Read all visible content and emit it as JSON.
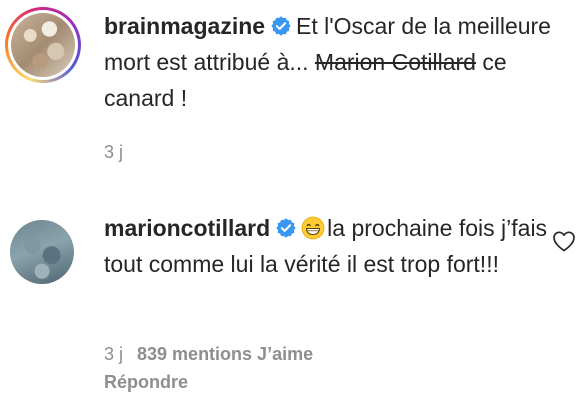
{
  "comments": [
    {
      "username": "brainmagazine",
      "text_before": "Et l'Oscar de la meilleure mort est attribué à... ",
      "strikethrough_text": "Marion Cotillard",
      "text_after": " ce canard !",
      "time": "3 j"
    },
    {
      "username": "marioncotillard",
      "emoji": "grinning-face-with-smiling-eyes",
      "text": "la prochaine fois j’fais tout comme lui la vérité il est trop fort!!!",
      "time": "3 j",
      "likes": "839 mentions J’aime",
      "reply_label": "Répondre"
    }
  ],
  "icons": {
    "verified": "verified-badge-icon",
    "like": "heart-outline-icon"
  },
  "colors": {
    "verified_blue": "#3897f0",
    "text": "#262626",
    "meta": "#8e8e8e"
  }
}
